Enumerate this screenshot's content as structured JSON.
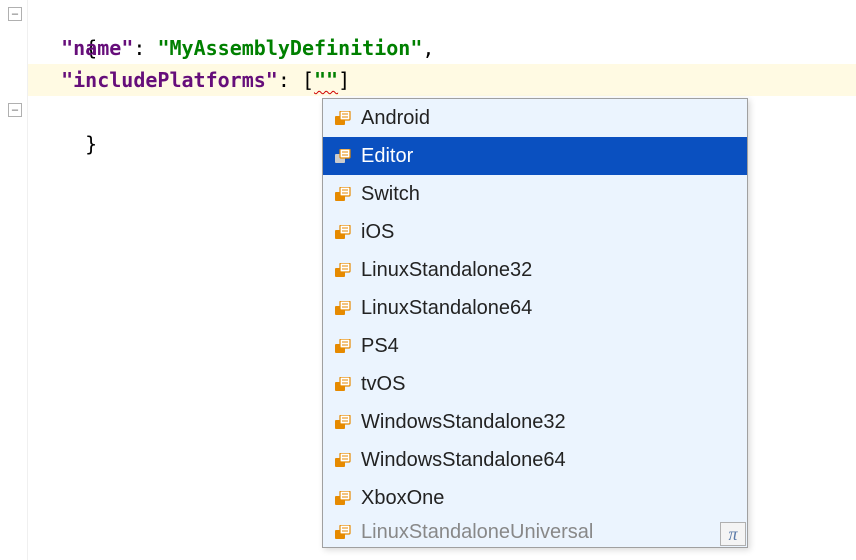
{
  "code": {
    "line1": "{",
    "line2_indent": "  ",
    "line2_key_quote_open": "\"",
    "line2_key": "name",
    "line2_key_quote_close": "\"",
    "line2_colon": ": ",
    "line2_value": "\"MyAssemblyDefinition\"",
    "line2_comma": ",",
    "line3_indent": "  ",
    "line3_key_quote_open": "\"",
    "line3_key": "includePlatforms",
    "line3_key_quote_close": "\"",
    "line3_colon": ": ",
    "line3_bracket_open": "[",
    "line3_cursor_val": "\"\"",
    "line3_bracket_close": "]",
    "line4": "}"
  },
  "completion": {
    "items": [
      {
        "label": "Android",
        "selected": false
      },
      {
        "label": "Editor",
        "selected": true
      },
      {
        "label": "Switch",
        "selected": false
      },
      {
        "label": "iOS",
        "selected": false
      },
      {
        "label": "LinuxStandalone32",
        "selected": false
      },
      {
        "label": "LinuxStandalone64",
        "selected": false
      },
      {
        "label": "PS4",
        "selected": false
      },
      {
        "label": "tvOS",
        "selected": false
      },
      {
        "label": "WindowsStandalone32",
        "selected": false
      },
      {
        "label": "WindowsStandalone64",
        "selected": false
      },
      {
        "label": "XboxOne",
        "selected": false
      }
    ],
    "partial_item": "LinuxStandaloneUniversal"
  },
  "pi_symbol": "π"
}
